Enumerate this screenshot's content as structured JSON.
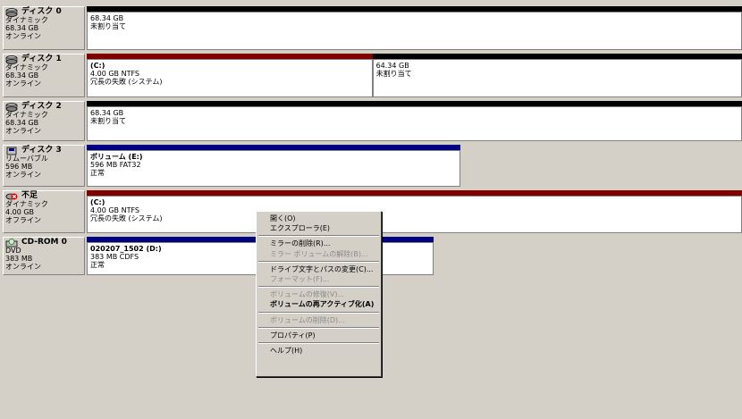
{
  "disks": [
    {
      "name": "ディスク 0",
      "type": "ダイナミック",
      "size": "68.34 GB",
      "status": "オンライン",
      "icon": "disk-icon",
      "volumes": [
        {
          "label": "",
          "line1": "68.34 GB",
          "line2": "未割り当て",
          "bar": "black",
          "w": 100
        }
      ]
    },
    {
      "name": "ディスク 1",
      "type": "ダイナミック",
      "size": "68.34 GB",
      "status": "オンライン",
      "icon": "disk-icon",
      "volumes": [
        {
          "label": "(C:)",
          "line1": "4.00 GB NTFS",
          "line2": "冗長の失敗 (システム)",
          "bar": "maroon",
          "w": 43.6
        },
        {
          "label": "",
          "line1": "64.34 GB",
          "line2": "未割り当て",
          "bar": "black",
          "w": 56.4
        }
      ]
    },
    {
      "name": "ディスク 2",
      "type": "ダイナミック",
      "size": "68.34 GB",
      "status": "オンライン",
      "icon": "disk-icon",
      "volumes": [
        {
          "label": "",
          "line1": "68.34 GB",
          "line2": "未割り当て",
          "bar": "black",
          "w": 100
        }
      ]
    },
    {
      "name": "ディスク 3",
      "type": "リムーバブル",
      "size": "596 MB",
      "status": "オンライン",
      "icon": "removable-disk-icon",
      "volumes": [
        {
          "label": "ボリューム (E:)",
          "line1": "596 MB FAT32",
          "line2": "正常",
          "bar": "navy",
          "w": 57
        }
      ]
    },
    {
      "name": "不足",
      "type": "ダイナミック",
      "size": "4.00 GB",
      "status": "オフライン",
      "icon": "missing-disk-icon",
      "volumes": [
        {
          "label": "(C:)",
          "line1": "4.00 GB NTFS",
          "line2": "冗長の失敗 (システム)",
          "bar": "maroon",
          "w": 100,
          "hatch": true
        }
      ]
    },
    {
      "name": "CD-ROM 0",
      "type": "DVD",
      "size": "383 MB",
      "status": "オンライン",
      "icon": "cdrom-icon",
      "volumes": [
        {
          "label": "020207_1502 (D:)",
          "line1": "383 MB CDFS",
          "line2": "正常",
          "bar": "navy",
          "w": 53
        }
      ]
    }
  ],
  "context_menu": [
    {
      "label": "開く(O)",
      "state": "enabled"
    },
    {
      "label": "エクスプローラ(E)",
      "state": "enabled"
    },
    {
      "sep": true
    },
    {
      "label": "ミラーの削除(R)...",
      "state": "enabled"
    },
    {
      "label": "ミラー ボリュームの解除(B)...",
      "state": "disabled"
    },
    {
      "sep": true
    },
    {
      "label": "ドライブ文字とパスの変更(C)...",
      "state": "enabled"
    },
    {
      "label": "フォーマット(F)...",
      "state": "disabled"
    },
    {
      "sep": true
    },
    {
      "label": "ボリュームの修復(V)...",
      "state": "disabled"
    },
    {
      "label": "ボリュームの再アクティブ化(A)",
      "state": "bold"
    },
    {
      "sep": true
    },
    {
      "label": "ボリュームの削除(D)...",
      "state": "disabled"
    },
    {
      "sep": true
    },
    {
      "label": "プロパティ(P)",
      "state": "enabled"
    },
    {
      "sep": true
    },
    {
      "label": "ヘルプ(H)",
      "state": "enabled"
    }
  ]
}
